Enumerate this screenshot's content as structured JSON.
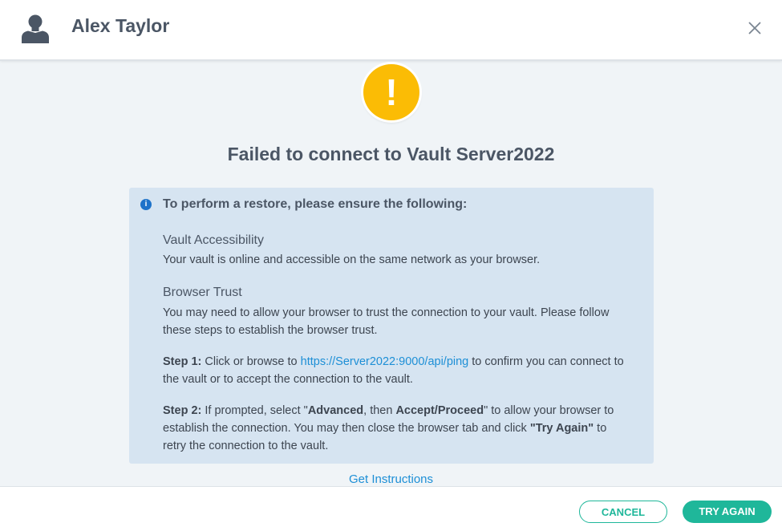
{
  "header": {
    "user_name": "Alex Taylor",
    "avatar_icon": "person-icon",
    "close_icon": "close-icon"
  },
  "alert": {
    "icon": "warning-icon",
    "symbol": "!",
    "title": "Failed to connect to Vault Server2022"
  },
  "info_panel": {
    "icon": "info-icon",
    "icon_symbol": "i",
    "heading": "To perform a restore, please ensure the following:",
    "vault_accessibility": {
      "title": "Vault Accessibility",
      "text": "Your vault is online and accessible on the same network as your browser."
    },
    "browser_trust": {
      "title": "Browser Trust",
      "text_line1": "You may need to allow your browser to trust the connection to your vault. Please follow",
      "text_line2": "these steps to establish the browser trust."
    },
    "step1": {
      "label": "Step 1:",
      "before_link": " Click or browse to ",
      "link": "https://Server2022:9000/api/ping",
      "after_link": " to confirm you can connect to",
      "line2": "the vault or to accept the connection to the vault."
    },
    "step2": {
      "label": "Step 2:",
      "t1": " If prompted, select \"",
      "advanced": "Advanced",
      "t2": ", then ",
      "accept": "Accept/Proceed",
      "t3": "\" to allow your browser to",
      "line2_a": "establish the connection. You may then close the browser tab and click ",
      "try_again": "\"Try Again\"",
      "line2_b": " to",
      "line3": "retry the connection to the vault."
    }
  },
  "get_instructions": "Get Instructions",
  "footer": {
    "cancel_label": "CANCEL",
    "try_again_label": "TRY AGAIN"
  },
  "colors": {
    "accent": "#1fb79a",
    "warning": "#fbbc05",
    "info": "#1d72c9",
    "link": "#1d8fd6",
    "panel": "#d6e4f1"
  }
}
